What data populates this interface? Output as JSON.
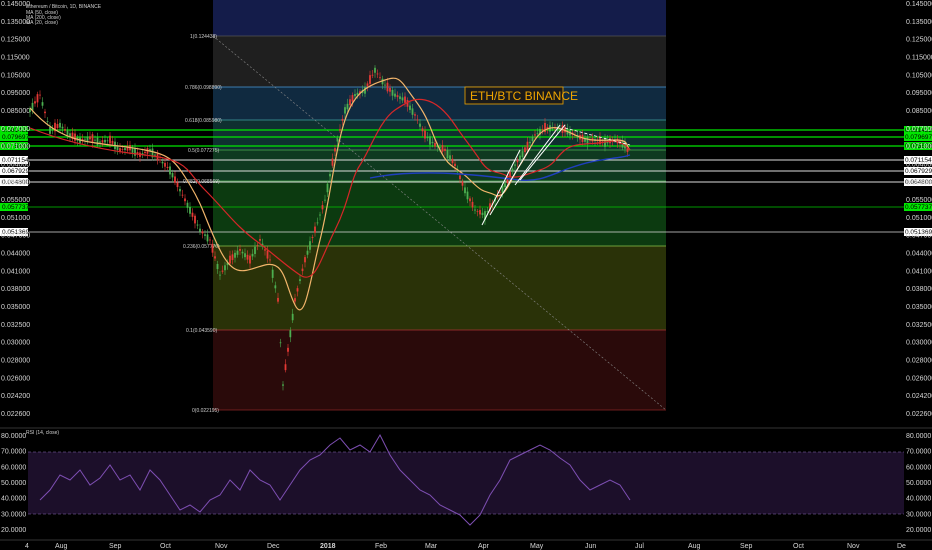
{
  "header": {
    "symbol_line": "Ethereum / Bitcoin, 1D, BINANCE",
    "indicator_lines": [
      "MA (50, close)",
      "MA (200, close)",
      "MA (20, close)"
    ],
    "rsi_label": "RSI (14, close)"
  },
  "chart_data": {
    "type": "candlestick",
    "title": "ETH/BTC BINANCE",
    "x_labels": [
      "4",
      "Aug",
      "Sep",
      "Oct",
      "Nov",
      "Dec",
      "2018",
      "Feb",
      "Mar",
      "Apr",
      "May",
      "Jun",
      "Jul",
      "Aug",
      "Sep",
      "Oct",
      "Nov",
      "De"
    ],
    "y_ticks": [
      "0.145000",
      "0.135000",
      "0.125000",
      "0.115000",
      "0.105000",
      "0.095000",
      "0.085000",
      "0.077000",
      "0.071000",
      "0.064000",
      "0.058000",
      "0.055000",
      "0.051000",
      "0.047000",
      "0.044000",
      "0.041000",
      "0.038000",
      "0.035000",
      "0.032500",
      "0.030000",
      "0.028000",
      "0.026000",
      "0.024200",
      "0.022600"
    ],
    "price_line_labels": [
      {
        "value": "0.081422",
        "color": "#00e600"
      },
      {
        "value": "0.079697",
        "color": "#00e600"
      },
      {
        "value": "0.075838",
        "color": "#00e600"
      },
      {
        "value": "0.071154",
        "color": "#ffffff"
      },
      {
        "value": "0.067929",
        "color": "#ffffff"
      },
      {
        "value": "0.064800",
        "color": "#ffffff"
      },
      {
        "value": "0.057737",
        "color": "#00e600"
      },
      {
        "value": "0.051369",
        "color": "#ffffff"
      }
    ],
    "fib_levels": [
      {
        "level": "1(0.124438)",
        "color": "#555555"
      },
      {
        "level": "0.786(0.098890)",
        "color": "#4a9ad8"
      },
      {
        "level": "0.618(0.085980)",
        "color": "#3fa0a0"
      },
      {
        "level": "0.5(0.077275)",
        "color": "#4caf50"
      },
      {
        "level": "0.382(0.068569)",
        "color": "#4caf50"
      },
      {
        "level": "0.236(0.057776)",
        "color": "#4caf50"
      },
      {
        "level": "0(0.022195)",
        "color": "#8a2525"
      }
    ],
    "fib_extra_levels": [
      "0.1(0.043590)",
      "0.11(0.028270)"
    ],
    "rsi": {
      "ticks": [
        "80.0000",
        "70.0000",
        "60.0000",
        "50.0000",
        "40.0000",
        "30.0000",
        "20.0000"
      ],
      "overbought": 70,
      "oversold": 30
    }
  }
}
